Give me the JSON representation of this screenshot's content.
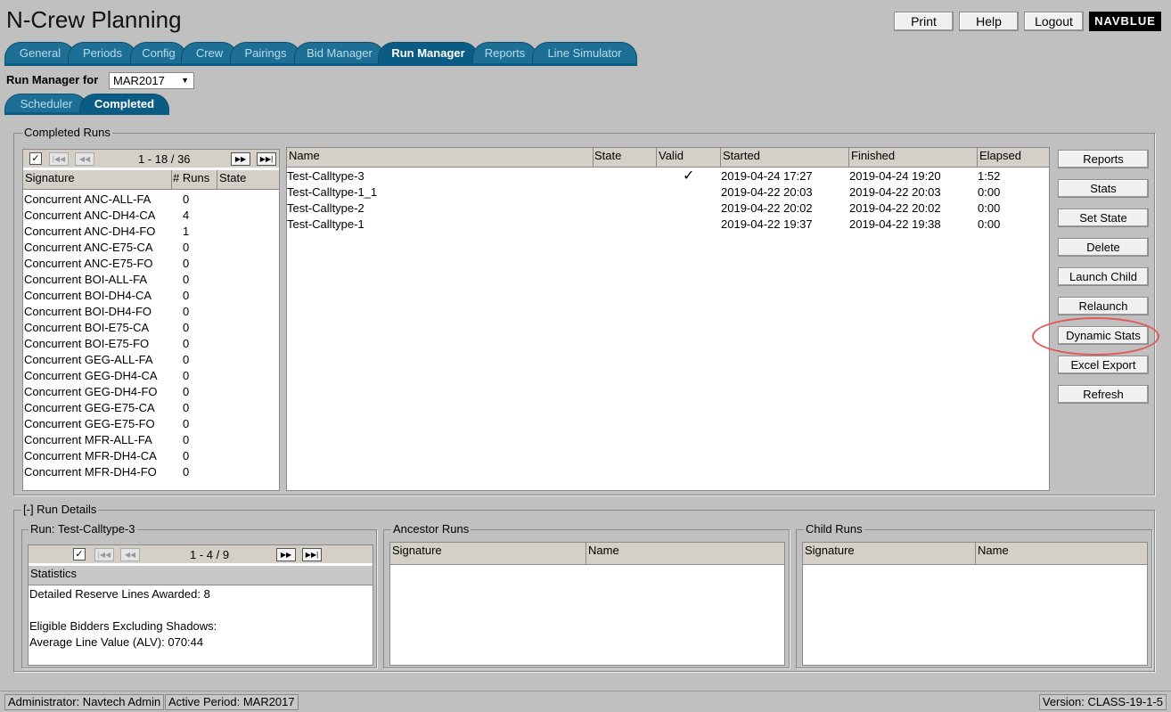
{
  "app": {
    "title": "N-Crew Planning",
    "logo": "NAVBLUE"
  },
  "top_buttons": {
    "print": "Print",
    "help": "Help",
    "logout": "Logout"
  },
  "nav_tabs": [
    "General",
    "Periods",
    "Config",
    "Crew",
    "Pairings",
    "Bid Manager",
    "Run Manager",
    "Reports",
    "Line Simulator"
  ],
  "run_manager": {
    "label": "Run Manager for",
    "period": "MAR2017",
    "select_arrow": "▼"
  },
  "sub_tabs": [
    "Scheduler",
    "Completed"
  ],
  "completed_runs": {
    "legend": "Completed Runs",
    "pager": {
      "text": "1 - 18 / 36",
      "checked": "✓"
    },
    "sig_columns": [
      "Signature",
      "# Runs",
      "State"
    ],
    "signatures": [
      {
        "name": "Concurrent ANC-ALL-FA",
        "runs": "0"
      },
      {
        "name": "Concurrent ANC-DH4-CA",
        "runs": "4"
      },
      {
        "name": "Concurrent ANC-DH4-FO",
        "runs": "1"
      },
      {
        "name": "Concurrent ANC-E75-CA",
        "runs": "0"
      },
      {
        "name": "Concurrent ANC-E75-FO",
        "runs": "0"
      },
      {
        "name": "Concurrent BOI-ALL-FA",
        "runs": "0"
      },
      {
        "name": "Concurrent BOI-DH4-CA",
        "runs": "0"
      },
      {
        "name": "Concurrent BOI-DH4-FO",
        "runs": "0"
      },
      {
        "name": "Concurrent BOI-E75-CA",
        "runs": "0"
      },
      {
        "name": "Concurrent BOI-E75-FO",
        "runs": "0"
      },
      {
        "name": "Concurrent GEG-ALL-FA",
        "runs": "0"
      },
      {
        "name": "Concurrent GEG-DH4-CA",
        "runs": "0"
      },
      {
        "name": "Concurrent GEG-DH4-FO",
        "runs": "0"
      },
      {
        "name": "Concurrent GEG-E75-CA",
        "runs": "0"
      },
      {
        "name": "Concurrent GEG-E75-FO",
        "runs": "0"
      },
      {
        "name": "Concurrent MFR-ALL-FA",
        "runs": "0"
      },
      {
        "name": "Concurrent MFR-DH4-CA",
        "runs": "0"
      },
      {
        "name": "Concurrent MFR-DH4-FO",
        "runs": "0"
      }
    ],
    "run_columns": [
      "Name",
      "State",
      "Valid",
      "Started",
      "Finished",
      "Elapsed"
    ],
    "runs": [
      {
        "name": "Test-Calltype-3",
        "state": "",
        "valid": "✓",
        "started": "2019-04-24 17:27",
        "finished": "2019-04-24 19:20",
        "elapsed": "1:52"
      },
      {
        "name": "Test-Calltype-1_1",
        "state": "",
        "valid": "",
        "started": "2019-04-22 20:03",
        "finished": "2019-04-22 20:03",
        "elapsed": "0:00"
      },
      {
        "name": "Test-Calltype-2",
        "state": "",
        "valid": "",
        "started": "2019-04-22 20:02",
        "finished": "2019-04-22 20:02",
        "elapsed": "0:00"
      },
      {
        "name": "Test-Calltype-1",
        "state": "",
        "valid": "",
        "started": "2019-04-22 19:37",
        "finished": "2019-04-22 19:38",
        "elapsed": "0:00"
      }
    ],
    "actions": [
      "Reports",
      "Stats",
      "Set State",
      "Delete",
      "Launch Child",
      "Relaunch",
      "Dynamic Stats",
      "Excel Export",
      "Refresh"
    ]
  },
  "run_details": {
    "legend": "[-] Run Details",
    "run_legend": "Run: Test-Calltype-3",
    "pager": {
      "text": "1 - 4 / 9",
      "checked": "✓"
    },
    "stats_header": "Statistics",
    "stats_lines": [
      "Detailed Reserve Lines Awarded: 8",
      "",
      "Eligible Bidders Excluding Shadows:",
      "Average Line Value (ALV): 070:44"
    ],
    "ancestor_legend": "Ancestor Runs",
    "ancestor_columns": [
      "Signature",
      "Name"
    ],
    "child_legend": "Child Runs",
    "child_columns": [
      "Signature",
      "Name"
    ]
  },
  "status_bar": {
    "user": "Administrator: Navtech Admin",
    "period": "Active Period: MAR2017",
    "version": "Version: CLASS-19-1-5"
  }
}
